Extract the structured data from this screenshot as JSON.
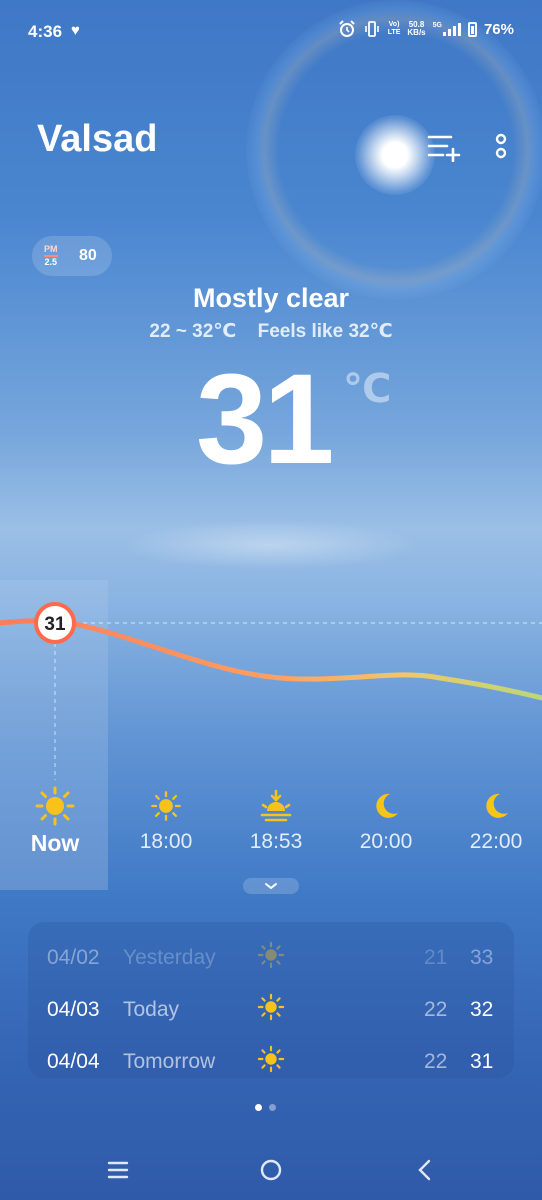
{
  "status_bar": {
    "time": "4:36",
    "speed_value": "50.8",
    "speed_unit": "KB/s",
    "net_label_top": "Vo)",
    "net_label_bottom": "LTE",
    "network": "5G",
    "battery": "76%"
  },
  "header": {
    "city": "Valsad"
  },
  "air_quality": {
    "label_top": "PM",
    "label_bottom": "2.5",
    "value": "80"
  },
  "current": {
    "condition": "Mostly clear",
    "range": "22 ~ 32℃",
    "feels_like": "Feels like 32℃",
    "temperature": "31",
    "unit": "℃"
  },
  "hourly_chart": {
    "marker_value": "31"
  },
  "hourly": [
    {
      "time": "Now",
      "icon": "sun-icon"
    },
    {
      "time": "18:00",
      "icon": "sun-icon"
    },
    {
      "time": "18:53",
      "icon": "sunset-icon"
    },
    {
      "time": "20:00",
      "icon": "moon-icon"
    },
    {
      "time": "22:00",
      "icon": "moon-icon"
    }
  ],
  "daily": [
    {
      "date": "04/02",
      "day": "Yesterday",
      "icon": "sun-icon",
      "low": "21",
      "high": "33"
    },
    {
      "date": "04/03",
      "day": "Today",
      "icon": "sun-icon",
      "low": "22",
      "high": "32"
    },
    {
      "date": "04/04",
      "day": "Tomorrow",
      "icon": "sun-icon",
      "low": "22",
      "high": "31"
    }
  ],
  "colors": {
    "sun": "#f8c21c",
    "moon": "#f6c515",
    "line_start": "#ff7b5a",
    "line_end": "#b9d77a"
  }
}
